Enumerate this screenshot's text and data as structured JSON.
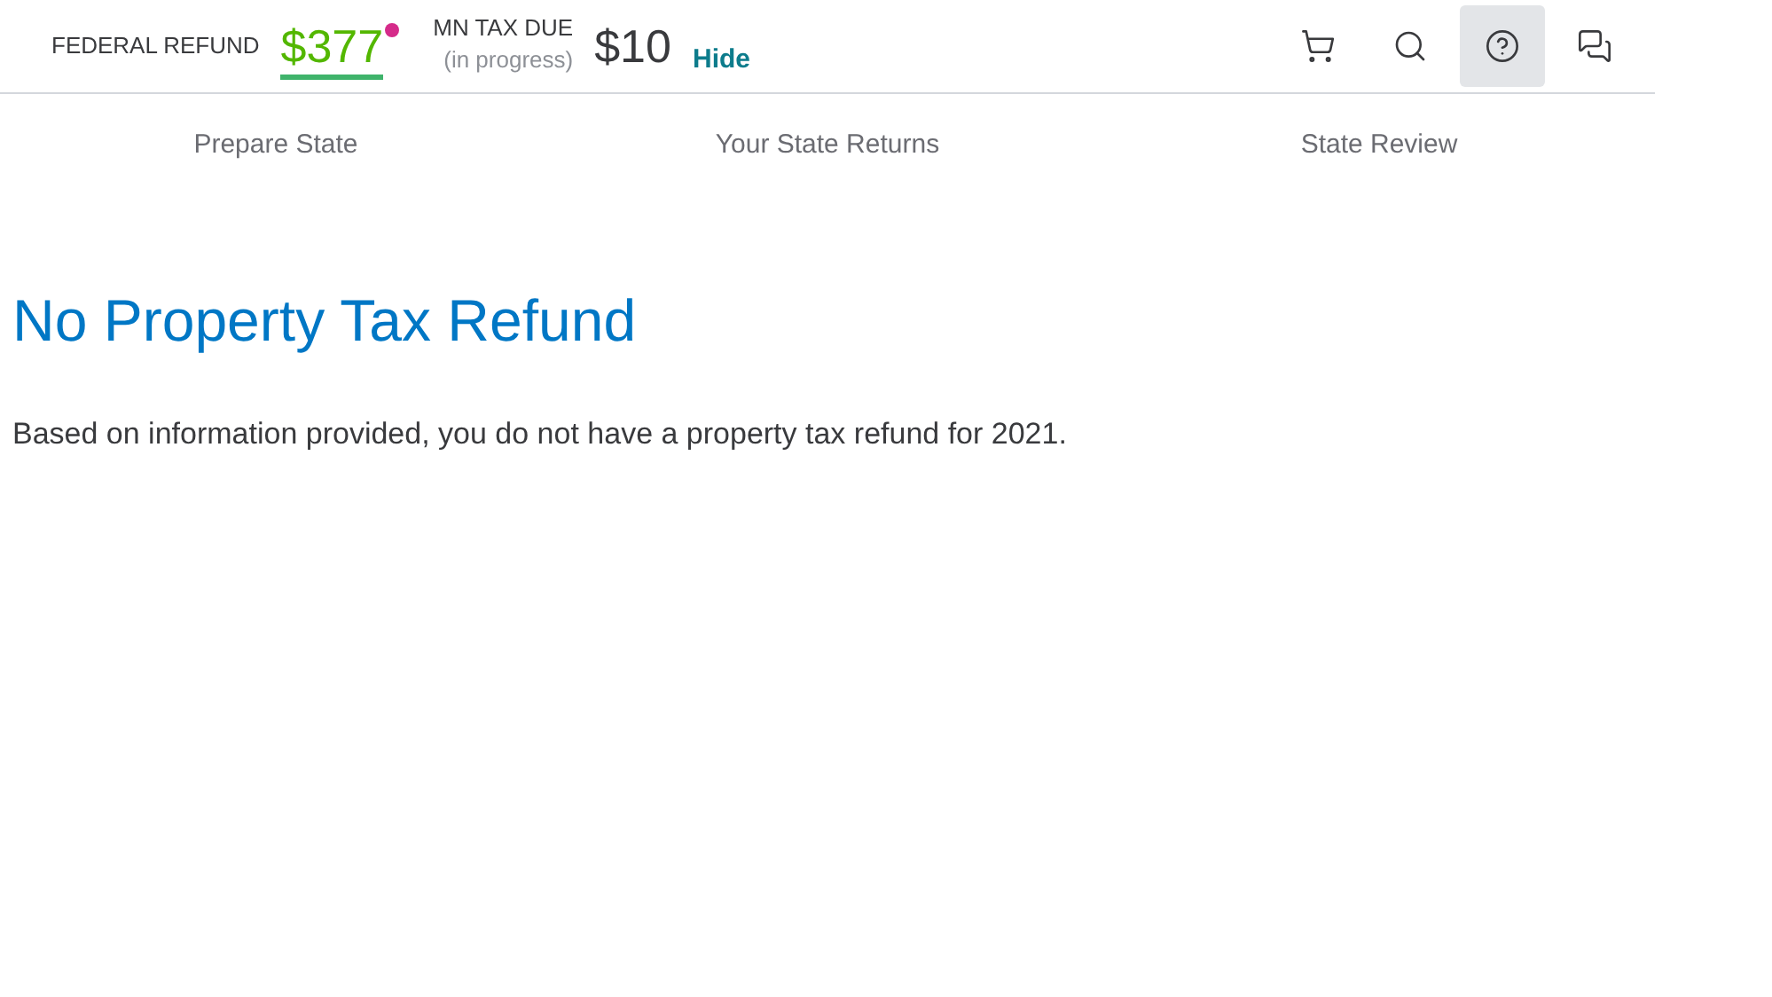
{
  "header": {
    "federal": {
      "label": "FEDERAL REFUND",
      "amount": "$377",
      "alert": true
    },
    "state": {
      "label": "MN TAX DUE",
      "status": "(in progress)",
      "amount": "$10"
    },
    "hide_link": "Hide",
    "toolbar": [
      {
        "kind": "cart",
        "selected": false
      },
      {
        "kind": "search",
        "selected": false
      },
      {
        "kind": "help",
        "selected": true
      },
      {
        "kind": "chat",
        "selected": false
      }
    ]
  },
  "steps": [
    "Prepare State",
    "Your State Returns",
    "State Review"
  ],
  "title": "No Property Tax Refund",
  "message": "Based on information provided, you do not have a property tax refund for 2021."
}
